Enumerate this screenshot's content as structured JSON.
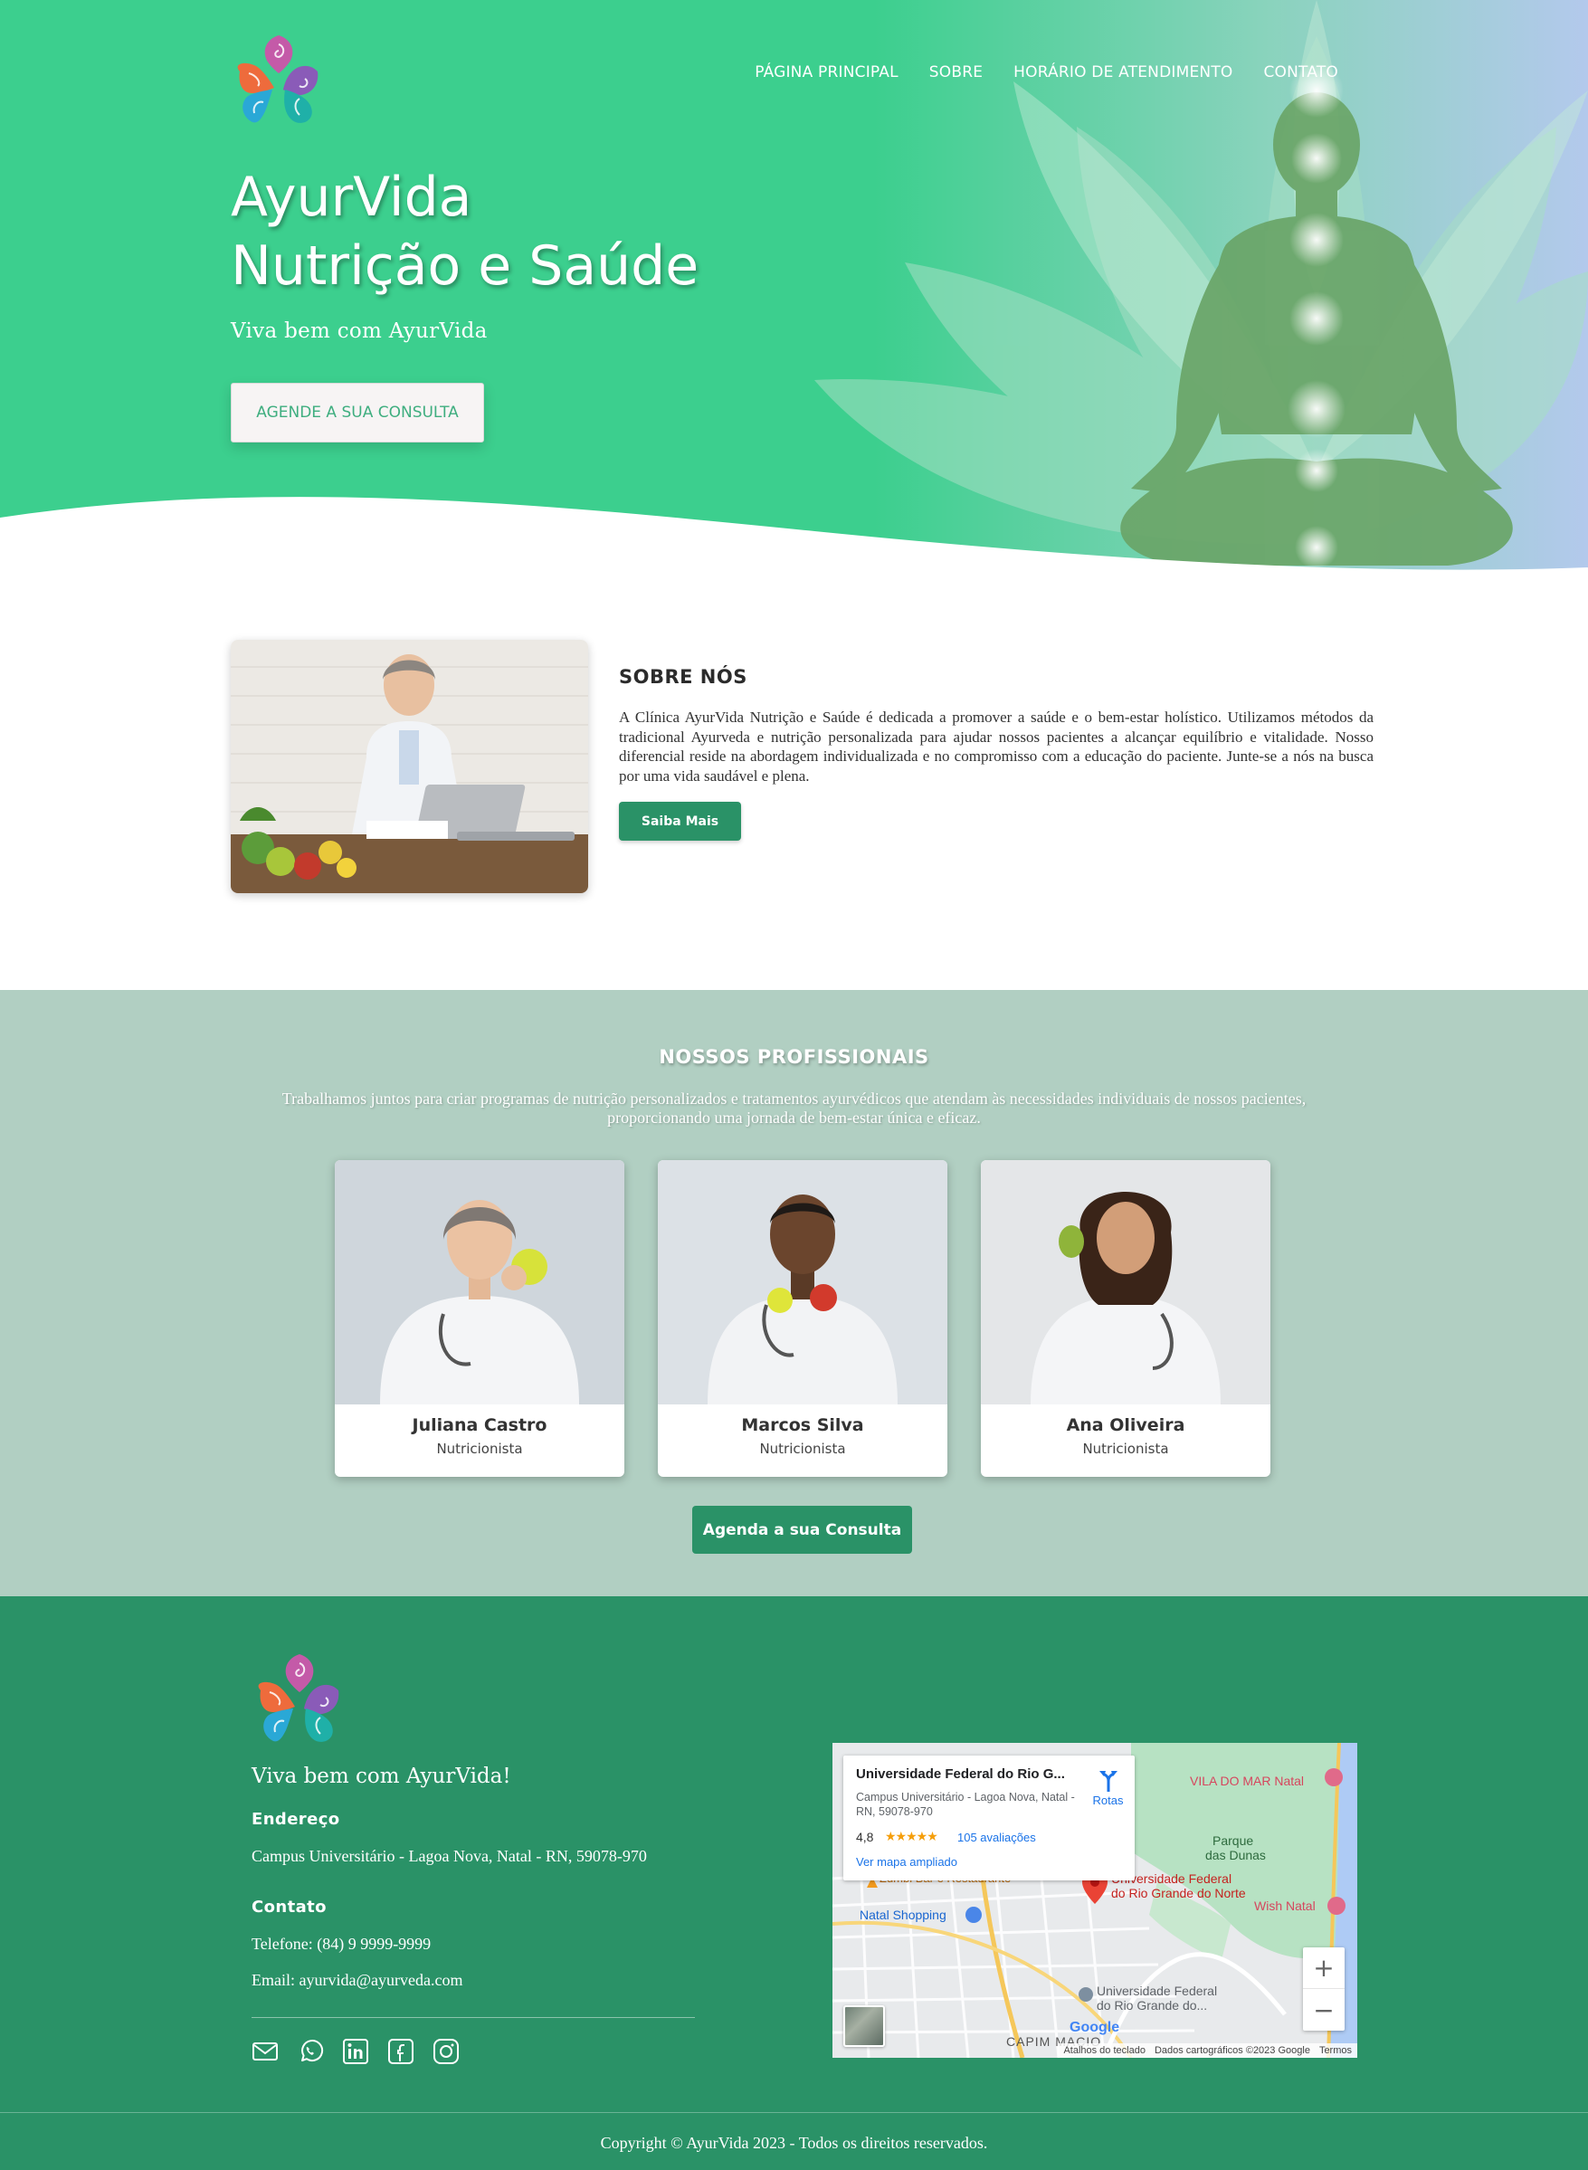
{
  "colors": {
    "hero_green": "#3ccf8e",
    "brand_green": "#2a9267",
    "team_bg": "#b1cfc2",
    "hero_button_text": "#3fae7f"
  },
  "nav": {
    "items": [
      "PÁGINA PRINCIPAL",
      "SOBRE",
      "HORÁRIO DE ATENDIMENTO",
      "CONTATO"
    ]
  },
  "hero": {
    "title_line1": "AyurVida",
    "title_line2": "Nutrição e Saúde",
    "subtitle": "Viva bem com AyurVida",
    "cta": "AGENDE A SUA CONSULTA"
  },
  "about": {
    "title": "SOBRE NÓS",
    "text": "A Clínica AyurVida Nutrição e Saúde é dedicada a promover a saúde e o bem-estar holístico. Utilizamos métodos da tradicional Ayurveda e nutrição personalizada para ajudar nossos pacientes a alcançar equilíbrio e vitalidade. Nosso diferencial reside na abordagem individualizada e no compromisso com a educação do paciente. Junte-se a nós na busca por uma vida saudável e plena.",
    "button": "Saiba Mais"
  },
  "team": {
    "title": "NOSSOS PROFISSIONAIS",
    "description": "Trabalhamos juntos para criar programas de nutrição personalizados e tratamentos ayurvédicos que atendam às necessidades individuais de nossos pacientes, proporcionando uma jornada de bem-estar única e eficaz.",
    "members": [
      {
        "name": "Juliana Castro",
        "role": "Nutricionista"
      },
      {
        "name": "Marcos Silva",
        "role": "Nutricionista"
      },
      {
        "name": "Ana Oliveira",
        "role": "Nutricionista"
      }
    ],
    "button": "Agenda a sua Consulta"
  },
  "footer": {
    "slogan": "Viva bem com AyurVida!",
    "address_heading": "Endereço",
    "address": "Campus Universitário - Lagoa Nova, Natal - RN, 59078-970",
    "contact_heading": "Contato",
    "phone": "Telefone: (84) 9 9999-9999",
    "email": "Email: ayurvida@ayurveda.com",
    "socials": [
      "email-icon",
      "whatsapp-icon",
      "linkedin-icon",
      "facebook-icon",
      "instagram-icon"
    ],
    "copyright": "Copyright © AyurVida 2023 - Todos os direitos reservados."
  },
  "map": {
    "place_title": "Universidade Federal do Rio G...",
    "place_address": "Campus Universitário - Lagoa Nova, Natal - RN, 59078-970",
    "rating": "4,8",
    "stars": "★★★★★",
    "reviews": "105 avaliações",
    "view_larger": "Ver mapa ampliado",
    "directions": "Rotas",
    "labels": {
      "vila_do_mar": "VILA DO MAR Natal",
      "parque": "Parque",
      "das_dunas": "das Dunas",
      "ufrn_line1": "Universidade Federal",
      "ufrn_line2": "do Rio Grande do Norte",
      "wish": "Wish Natal",
      "natal_shopping": "Natal Shopping",
      "ufrn2_line1": "Universidade Federal",
      "ufrn2_line2": "do Rio Grande do...",
      "capim_macio": "CAPIM MACIO",
      "zumbi": "Zumbi Bar e Restaurante"
    },
    "zoom_in": "+",
    "zoom_out": "−",
    "attribution": [
      "Atalhos do teclado",
      "Dados cartográficos ©2023 Google",
      "Termos"
    ],
    "google": "Google"
  }
}
